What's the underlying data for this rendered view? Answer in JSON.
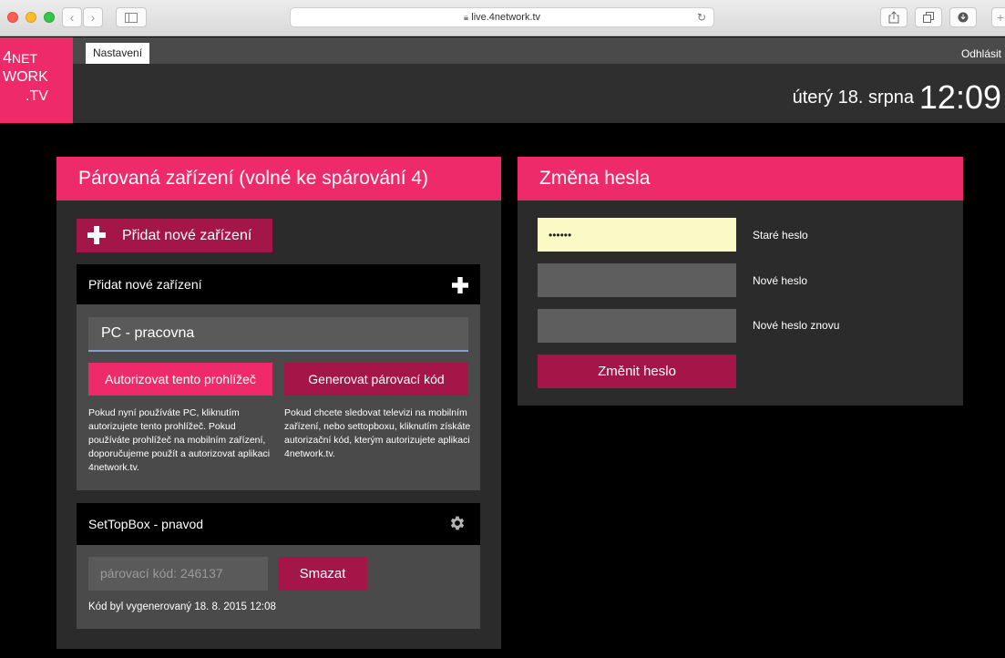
{
  "browser": {
    "url": "live.4network.tv",
    "lock_icon": "lock-icon",
    "back_icon": "chevron-left-icon",
    "forward_icon": "chevron-right-icon",
    "sidebar_icon": "sidebar-icon",
    "reload_icon": "reload-icon",
    "share_icon": "share-icon",
    "tabs_icon": "tabs-icon",
    "download_icon": "download-icon"
  },
  "header": {
    "logo": {
      "line1": "4",
      "line1b": "NET",
      "line2": "WORK",
      "line3": ".TV"
    },
    "tab_label": "Nastavení",
    "logout_label": "Odhlásit",
    "date": "úterý 18. srpna",
    "time": "12:09",
    "accent": "#ee2a6b"
  },
  "devices_panel": {
    "title": "Párovaná zařízení (volné ke spárování 4)",
    "add_button_label": "Přidat nové zařízení",
    "add_section": {
      "title": "Přidat nové zařízení",
      "name_value": "PC - pracovna",
      "authorize_label": "Autorizovat tento prohlížeč",
      "generate_label": "Generovat párovací kód",
      "authorize_desc": "Pokud nyní používáte PC, kliknutím autorizujete tento prohlížeč. Pokud používáte prohlížeč na mobilním zařízení, doporučujeme použít a autorizovat aplikaci 4network.tv.",
      "generate_desc": "Pokud chcete sledovat televizi na mobilním zařízení, nebo settopboxu, kliknutím získáte autorizační kód, kterým autorizujete aplikaci 4network.tv."
    },
    "device": {
      "name": "SetTopBox - pnavod",
      "pair_code_label": "párovací kód: 246137",
      "delete_label": "Smazat",
      "generated_note": "Kód byl vygenerovaný 18. 8. 2015 12:08"
    }
  },
  "password_panel": {
    "title": "Změna hesla",
    "old_value": "••••••",
    "old_label": "Staré heslo",
    "new_label": "Nové heslo",
    "new_again_label": "Nové heslo znovu",
    "submit_label": "Změnit heslo"
  }
}
